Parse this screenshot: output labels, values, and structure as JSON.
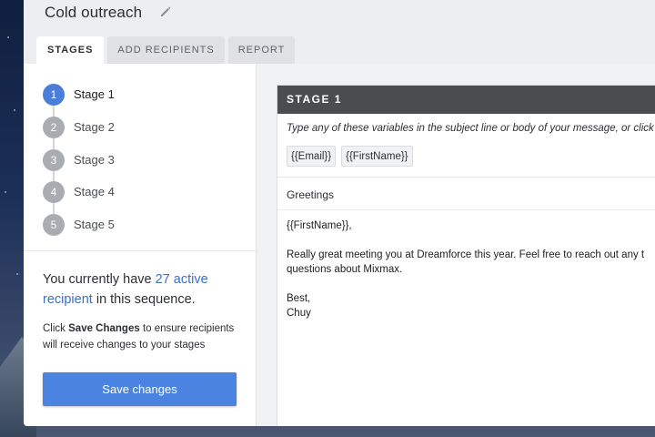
{
  "header": {
    "title": "Cold outreach",
    "tabs": [
      {
        "label": "STAGES",
        "active": true
      },
      {
        "label": "ADD RECIPIENTS",
        "active": false
      },
      {
        "label": "REPORT",
        "active": false
      }
    ]
  },
  "sidebar": {
    "stages": [
      {
        "num": "1",
        "label": "Stage 1",
        "active": true
      },
      {
        "num": "2",
        "label": "Stage 2",
        "active": false
      },
      {
        "num": "3",
        "label": "Stage 3",
        "active": false
      },
      {
        "num": "4",
        "label": "Stage 4",
        "active": false
      },
      {
        "num": "5",
        "label": "Stage 5",
        "active": false
      }
    ],
    "info_prefix": "You currently have ",
    "info_link": "27 active recipient",
    "info_suffix": " in this sequence.",
    "hint_prefix": "Click ",
    "hint_bold": "Save Changes",
    "hint_suffix": " to ensure recipients will receive changes to your stages",
    "save_label": "Save changes"
  },
  "editor": {
    "stage_title": "STAGE 1",
    "variables_hint": "Type any of these variables in the subject line or body of your message, or click",
    "variables": [
      "{{Email}}",
      "{{FirstName}}"
    ],
    "subject": "Greetings",
    "body": "{{FirstName}},\n\nReally great meeting you at Dreamforce this year. Feel free to reach out any t\nquestions about Mixmax.\n\nBest,\nChuy"
  },
  "colors": {
    "accent": "#4b84e0",
    "link": "#3c6fc9",
    "editor_header": "#4a4c50"
  }
}
